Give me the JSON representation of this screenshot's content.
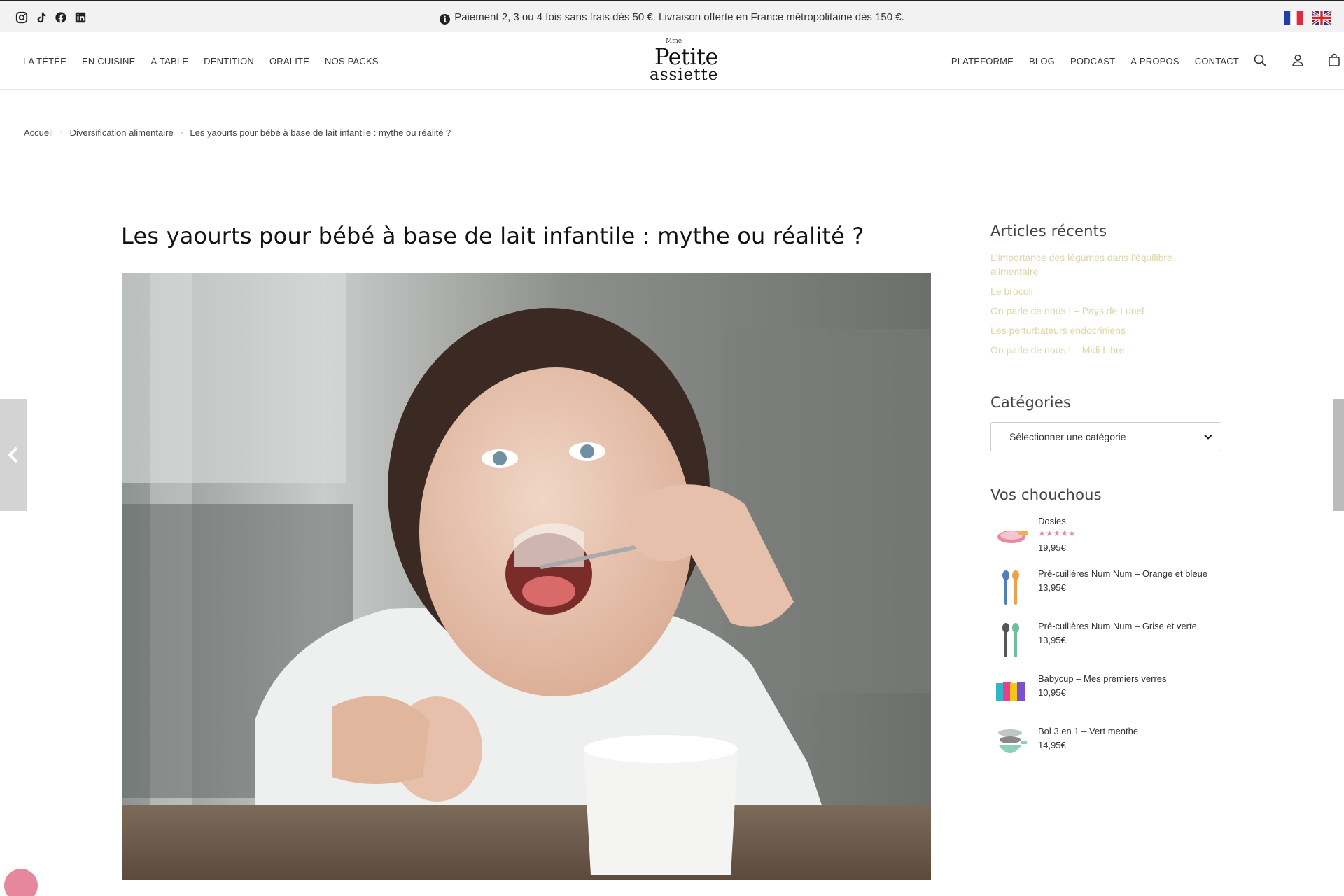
{
  "topbar": {
    "social": [
      "instagram-icon",
      "tiktok-icon",
      "facebook-icon",
      "linkedin-icon"
    ],
    "announcement": "Paiement 2, 3 ou 4 fois sans frais dès 50 €. Livraison offerte en France métropolitaine dès 150 €.",
    "languages": [
      "Français",
      "English"
    ]
  },
  "header": {
    "nav_left": [
      "LA TÉTÉE",
      "EN CUISINE",
      "À TABLE",
      "DENTITION",
      "ORALITÉ",
      "NOS PACKS"
    ],
    "nav_right": [
      "PLATEFORME",
      "BLOG",
      "PODCAST",
      "À PROPOS",
      "CONTACT"
    ],
    "logo": {
      "prefix": "Mme",
      "line1": "Petite",
      "line2": "assiette"
    }
  },
  "breadcrumb": [
    "Accueil",
    "Diversification alimentaire",
    "Les yaourts pour bébé à base de lait infantile : mythe ou réalité ?"
  ],
  "article": {
    "title": "Les yaourts pour bébé à base de lait infantile : mythe ou réalité ?"
  },
  "sidebar": {
    "recent_title": "Articles récents",
    "recent": [
      "L'importance des légumes dans l'équilibre alimentaire",
      "Le brocoli",
      "On parle de nous ! – Pays de Lunel",
      "Les perturbateurs endocriniens",
      "On parle de nous ! – Midi Libre"
    ],
    "categories_title": "Catégories",
    "categories_placeholder": "Sélectionner une catégorie",
    "favorites_title": "Vos chouchous",
    "products": [
      {
        "name": "Dosies",
        "stars": "★★★★★",
        "price": "19,95€"
      },
      {
        "name": "Pré-cuillères Num Num – Orange et bleue",
        "price": "13,95€"
      },
      {
        "name": "Pré-cuillères Num Num – Grise et verte",
        "price": "13,95€"
      },
      {
        "name": "Babycup – Mes premiers verres",
        "price": "10,95€"
      },
      {
        "name": "Bol 3 en 1 – Vert menthe",
        "price": "14,95€"
      }
    ]
  },
  "colors": {
    "link_recent": "#ddd6a8",
    "stars": "#e08b9c",
    "badge": "#e27b93"
  }
}
